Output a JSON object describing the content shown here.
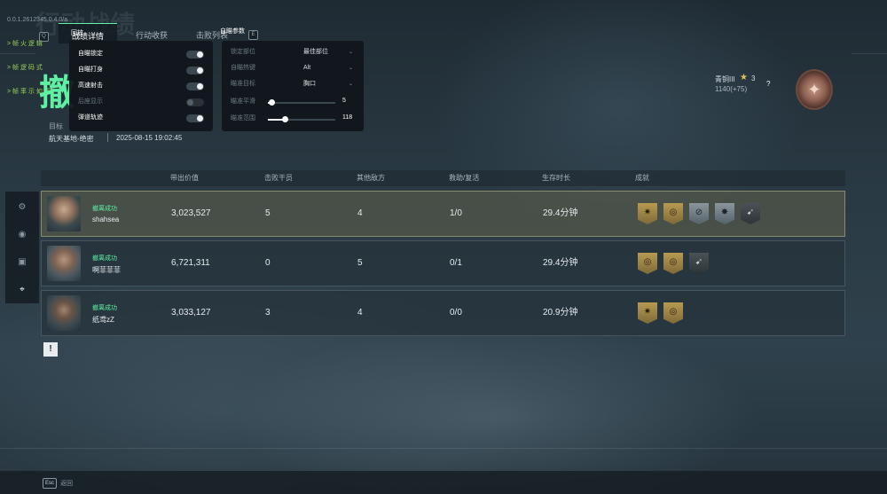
{
  "debug_lines": [
    "0.0.1.2612345.0.4.0/a",
    "> 帧 火 逻 辑",
    "> 帧 逻 码 式",
    "> 帧 率 示 如 图"
  ],
  "page": {
    "title": "撤",
    "faded_title": "行动战绩"
  },
  "keys": {
    "left": "Q",
    "right": "E",
    "esc": "Esc"
  },
  "tabs": [
    {
      "label": "战绩详情",
      "active": true
    },
    {
      "label": "行动收获",
      "active": false
    },
    {
      "label": "击败列表",
      "active": false
    }
  ],
  "toggles_panel": {
    "header": "回放",
    "items": [
      {
        "label": "自瞄锁定",
        "on": true,
        "dim": false
      },
      {
        "label": "自瞄打身",
        "on": true,
        "dim": false
      },
      {
        "label": "高速射击",
        "on": true,
        "dim": false
      },
      {
        "label": "后座显示",
        "on": false,
        "dim": true
      },
      {
        "label": "弹道轨迹",
        "on": true,
        "dim": false
      }
    ]
  },
  "settings_panel": {
    "header": "自瞄参数",
    "selects": [
      {
        "label": "锁定部位",
        "value": "最佳部位"
      },
      {
        "label": "自瞄热键",
        "value": "Alt"
      },
      {
        "label": "瞄准目标",
        "value": "胸口"
      }
    ],
    "sliders": [
      {
        "label": "瞄准平滑",
        "value": "5",
        "fraction": 0.05
      },
      {
        "label": "瞄准范围",
        "value": "118",
        "fraction": 0.25
      }
    ]
  },
  "meta": {
    "target_label": "目标",
    "map": "航天基地-绝密",
    "datetime": "2025-08-15 19:02:45"
  },
  "rank": {
    "name": "青铜III",
    "stars": "3",
    "score": "1140(+75)",
    "help": "?"
  },
  "table": {
    "headers": [
      "带出价值",
      "击败干员",
      "其他敌方",
      "救助/复活",
      "生存时长",
      "成就"
    ],
    "rows": [
      {
        "status": "撤离成功",
        "name": "shahsea",
        "value": "3,023,527",
        "kills": "5",
        "others": "4",
        "assist": "1/0",
        "survival": "29.4分钟",
        "badges": [
          "gold",
          "gold",
          "silver",
          "silver",
          "dark"
        ],
        "highlight": true
      },
      {
        "status": "撤离成功",
        "name": "啊菲菲菲",
        "value": "6,721,311",
        "kills": "0",
        "others": "5",
        "assist": "0/1",
        "survival": "29.4分钟",
        "badges": [
          "gold",
          "gold",
          "dark"
        ],
        "highlight": false
      },
      {
        "status": "撤离成功",
        "name": "纸鸢zZ",
        "value": "3,033,127",
        "kills": "3",
        "others": "4",
        "assist": "0/0",
        "survival": "20.9分钟",
        "badges": [
          "gold",
          "gold"
        ],
        "highlight": false
      }
    ]
  },
  "bottom": {
    "esc_label": "返回"
  }
}
